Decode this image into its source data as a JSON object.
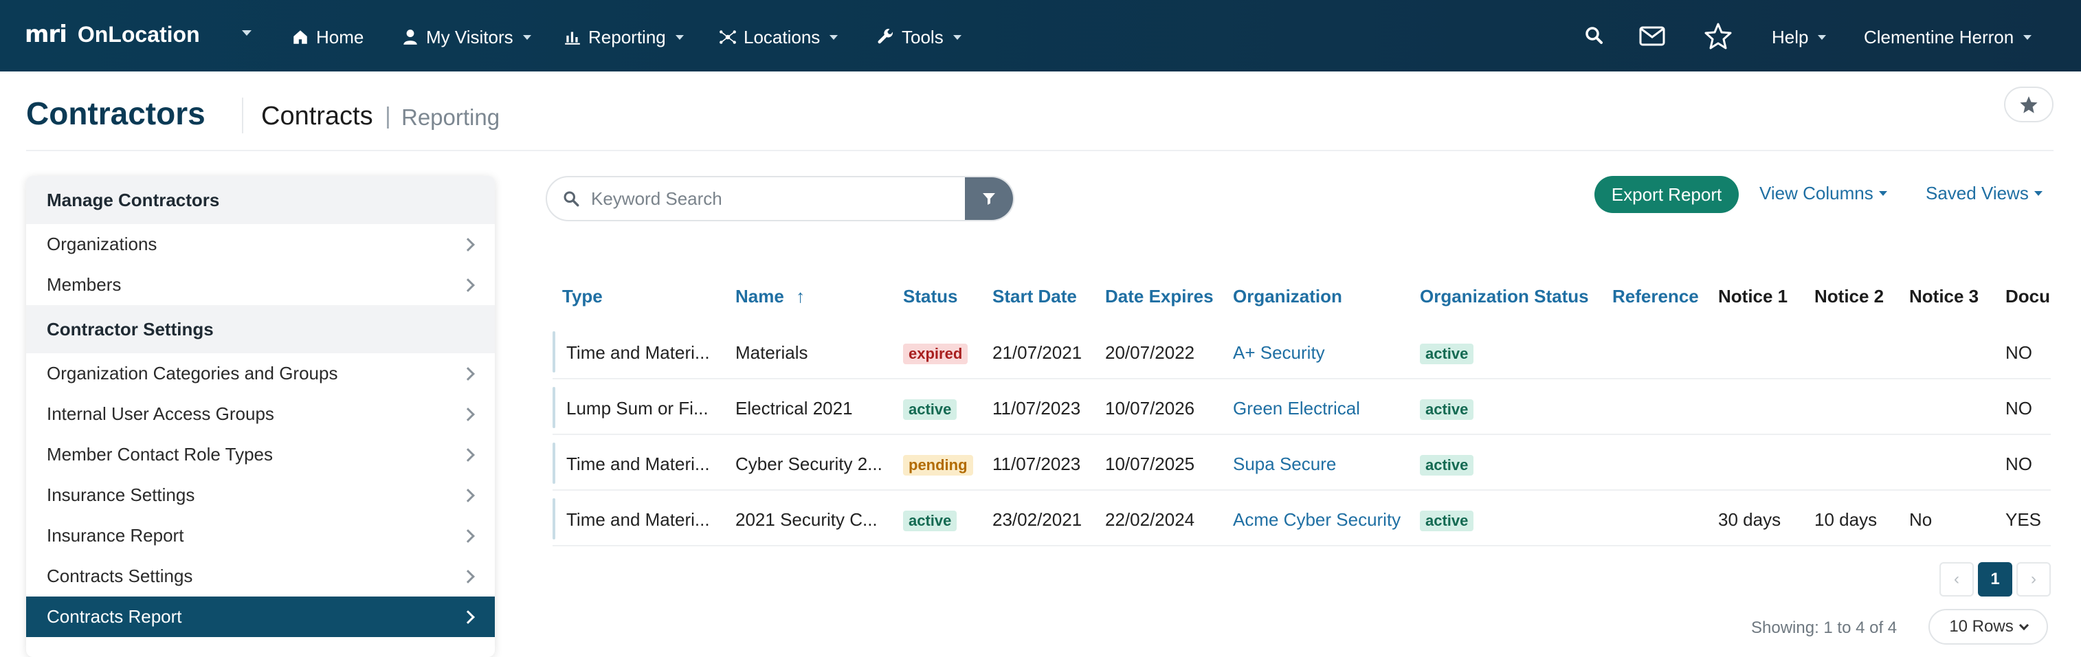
{
  "app": {
    "logo_mark": "mri",
    "logo_text": "OnLocation"
  },
  "nav": {
    "home": "Home",
    "my_visitors": "My Visitors",
    "reporting": "Reporting",
    "locations": "Locations",
    "tools": "Tools",
    "help": "Help",
    "user": "Clementine Herron"
  },
  "header": {
    "title": "Contractors",
    "subtitle": "Contracts",
    "separator": "|",
    "section": "Reporting"
  },
  "sidebar": {
    "sections": [
      {
        "title": "Manage Contractors",
        "items": [
          "Organizations",
          "Members"
        ]
      },
      {
        "title": "Contractor Settings",
        "items": [
          "Organization Categories and Groups",
          "Internal User Access Groups",
          "Member Contact Role Types",
          "Insurance Settings",
          "Insurance Report",
          "Contracts Settings",
          "Contracts Report"
        ]
      }
    ],
    "active_item": "Contracts Report"
  },
  "toolbar": {
    "search_placeholder": "Keyword Search",
    "export_label": "Export Report",
    "view_columns_label": "View Columns",
    "saved_views_label": "Saved Views"
  },
  "table": {
    "columns": {
      "type": "Type",
      "name": "Name",
      "sort_arrow": "↑",
      "status": "Status",
      "start_date": "Start Date",
      "date_expires": "Date Expires",
      "organization": "Organization",
      "organization_status": "Organization Status",
      "reference": "Reference",
      "notice1": "Notice 1",
      "notice2": "Notice 2",
      "notice3": "Notice 3",
      "documents": "Docu"
    },
    "rows": [
      {
        "type": "Time and Materi...",
        "name": "Materials",
        "status": "expired",
        "start": "21/07/2021",
        "expires": "20/07/2022",
        "org": "A+ Security",
        "org_status": "active",
        "reference": "",
        "n1": "",
        "n2": "",
        "n3": "",
        "docs": "NO"
      },
      {
        "type": "Lump Sum or Fi...",
        "name": "Electrical 2021",
        "status": "active",
        "start": "11/07/2023",
        "expires": "10/07/2026",
        "org": "Green Electrical",
        "org_status": "active",
        "reference": "",
        "n1": "",
        "n2": "",
        "n3": "",
        "docs": "NO"
      },
      {
        "type": "Time and Materi...",
        "name": "Cyber Security 2...",
        "status": "pending",
        "start": "11/07/2023",
        "expires": "10/07/2025",
        "org": "Supa Secure",
        "org_status": "active",
        "reference": "",
        "n1": "",
        "n2": "",
        "n3": "",
        "docs": "NO"
      },
      {
        "type": "Time and Materi...",
        "name": "2021 Security C...",
        "status": "active",
        "start": "23/02/2021",
        "expires": "22/02/2024",
        "org": "Acme Cyber Security",
        "org_status": "active",
        "reference": "",
        "n1": "30 days",
        "n2": "10 days",
        "n3": "No",
        "docs": "YES"
      }
    ]
  },
  "pagination": {
    "current_page": "1",
    "prev_symbol": "‹",
    "next_symbol": "›",
    "showing": "Showing: 1 to 4 of 4",
    "rows_label": "10 Rows"
  },
  "colors": {
    "navbar": "#0b3a55",
    "brand": "#0e4d6a",
    "link": "#1f6fa3",
    "export": "#12806b"
  }
}
